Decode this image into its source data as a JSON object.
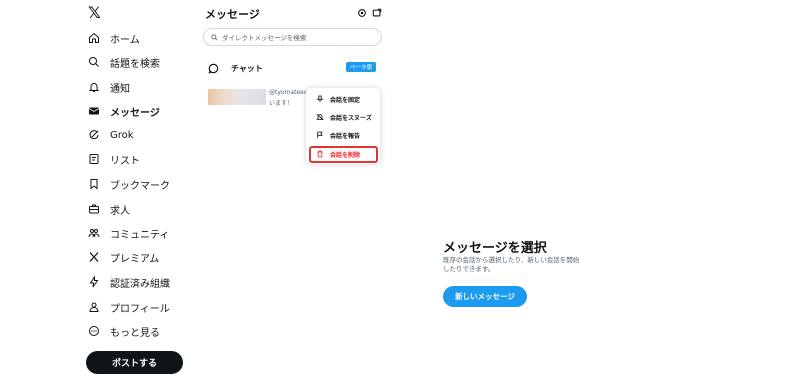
{
  "nav": {
    "logo": "𝕏",
    "items": [
      {
        "label": "ホーム",
        "icon": "home-icon"
      },
      {
        "label": "話題を検索",
        "icon": "search-icon"
      },
      {
        "label": "通知",
        "icon": "bell-icon"
      },
      {
        "label": "メッセージ",
        "icon": "envelope-icon"
      },
      {
        "label": "Grok",
        "icon": "grok-icon"
      },
      {
        "label": "リスト",
        "icon": "list-icon"
      },
      {
        "label": "ブックマーク",
        "icon": "bookmark-icon"
      },
      {
        "label": "求人",
        "icon": "briefcase-icon"
      },
      {
        "label": "コミュニティ",
        "icon": "community-icon"
      },
      {
        "label": "プレミアム",
        "icon": "x-icon"
      },
      {
        "label": "認証済み組織",
        "icon": "lightning-icon"
      },
      {
        "label": "プロフィール",
        "icon": "profile-icon"
      },
      {
        "label": "もっと見る",
        "icon": "more-circle-icon"
      }
    ],
    "post_label": "ポストする"
  },
  "messages": {
    "title": "メッセージ",
    "search_placeholder": "ダイレクトメッセージを検索",
    "chat_label": "チャット",
    "beta_label": "ベータ版",
    "conversation": {
      "handle": "@tyomateee · 7",
      "snippet": "います！"
    }
  },
  "context_menu": {
    "items": [
      {
        "label": "会話を固定",
        "icon": "pin-icon"
      },
      {
        "label": "会話をスヌーズ",
        "icon": "snooze-icon"
      },
      {
        "label": "会話を報告",
        "icon": "flag-icon"
      },
      {
        "label": "会話を削除",
        "icon": "trash-icon"
      }
    ]
  },
  "empty_state": {
    "title": "メッセージを選択",
    "description": "既存の会話から選択したり、新しい会話を開始したりできます。",
    "button_label": "新しいメッセージ"
  },
  "colors": {
    "accent": "#1d9bf0",
    "danger": "#f4212e",
    "highlight": "#e3342f"
  }
}
